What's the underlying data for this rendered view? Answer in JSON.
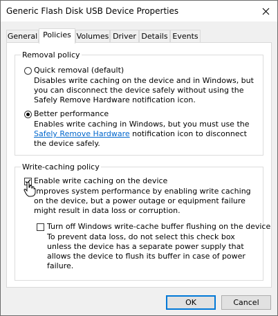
{
  "window": {
    "title": "Generic Flash Disk USB Device Properties"
  },
  "tabs": [
    {
      "label": "General"
    },
    {
      "label": "Policies"
    },
    {
      "label": "Volumes"
    },
    {
      "label": "Driver"
    },
    {
      "label": "Details"
    },
    {
      "label": "Events"
    }
  ],
  "removal_policy": {
    "legend": "Removal policy",
    "quick_label": "Quick removal (default)",
    "quick_desc": "Disables write caching on the device and in Windows, but you can disconnect the device safely without using the Safely Remove Hardware notification icon.",
    "better_label": "Better performance",
    "better_desc_pre": "Enables write caching in Windows, but you must use the",
    "better_desc_link": "Safely Remove Hardware",
    "better_desc_post": "notification icon to disconnect the device safely.",
    "selected": "better_performance"
  },
  "write_caching": {
    "legend": "Write-caching policy",
    "enable_label": "Enable write caching on the device",
    "enable_desc": "Improves system performance by enabling write caching on the device, but a power outage or equipment failure might result in data loss or corruption.",
    "enable_checked": true,
    "flush_label": "Turn off Windows write-cache buffer flushing on the device",
    "flush_desc": "To prevent data loss, do not select this check box unless the device has a separate power supply that allows the device to flush its buffer in case of power failure.",
    "flush_checked": false
  },
  "buttons": {
    "ok": "OK",
    "cancel": "Cancel"
  },
  "colors": {
    "link": "#0066cc",
    "default_button_border": "#0078d7"
  }
}
